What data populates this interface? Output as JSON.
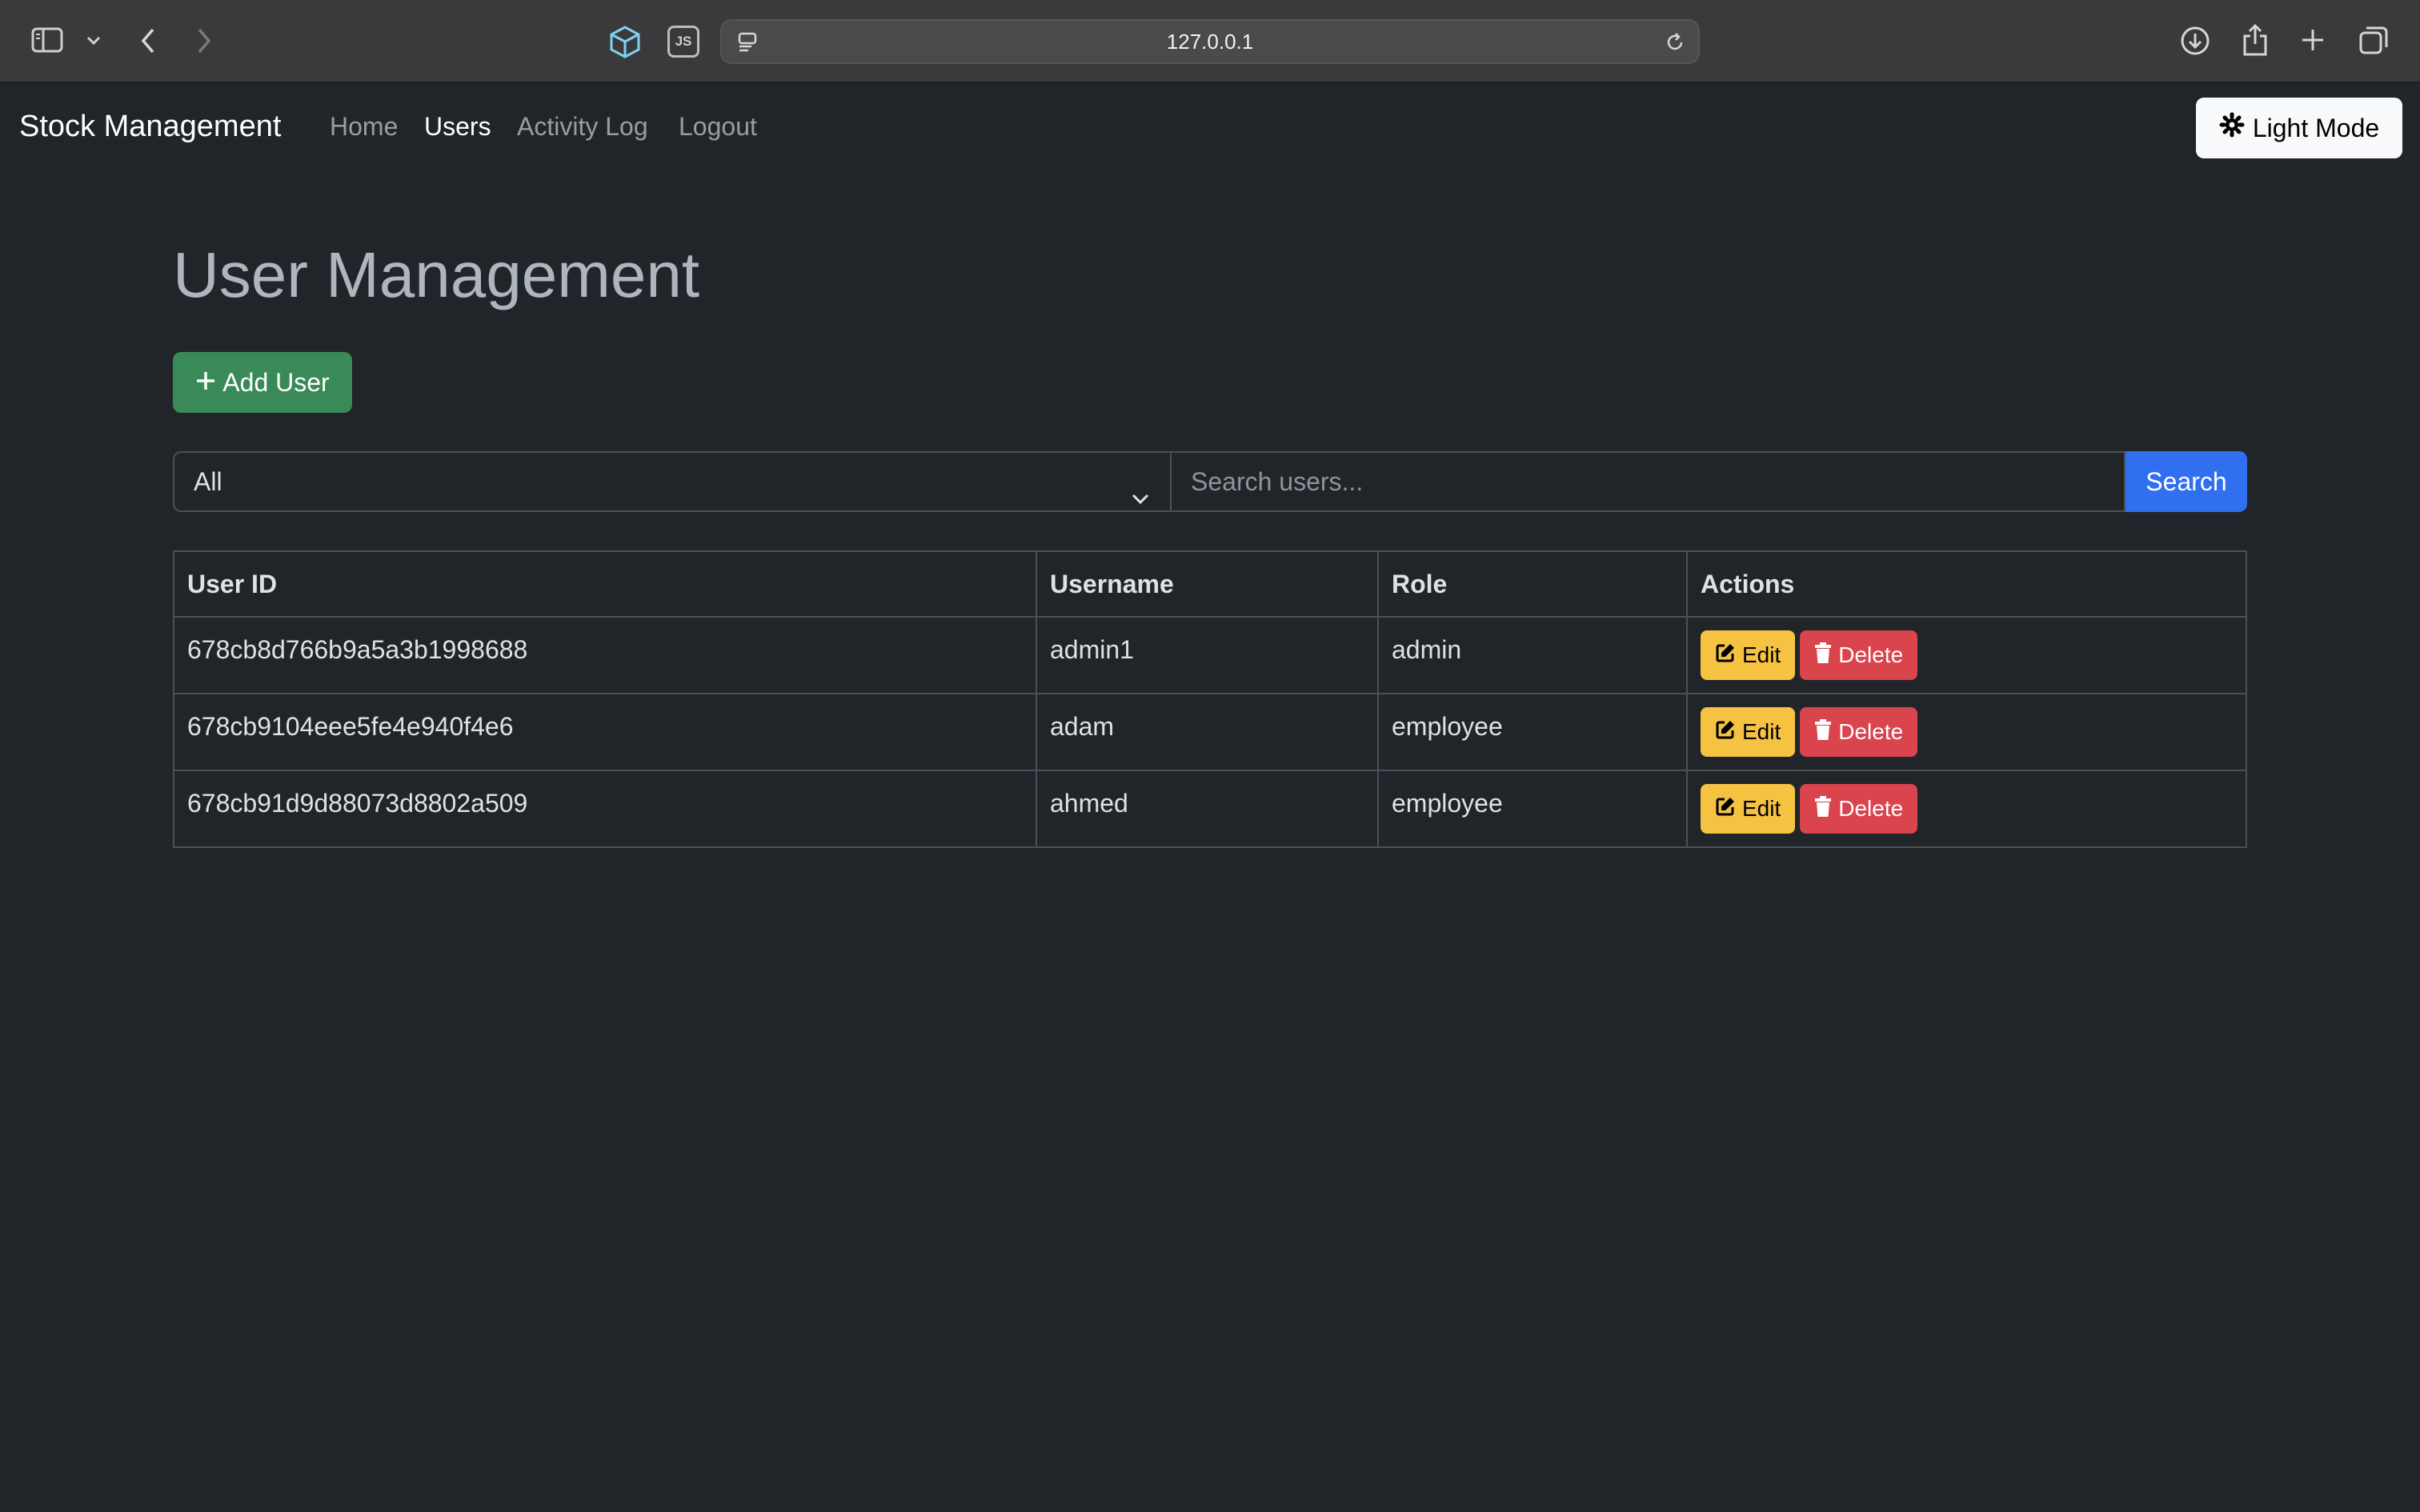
{
  "browser": {
    "url": "127.0.0.1",
    "js_badge": "JS"
  },
  "navbar": {
    "brand": "Stock Management",
    "links": [
      {
        "label": "Home",
        "active": false
      },
      {
        "label": "Users",
        "active": true
      },
      {
        "label": "Activity Log",
        "active": false
      },
      {
        "label": "Logout",
        "active": false
      }
    ],
    "theme_toggle_label": "Light Mode"
  },
  "page": {
    "title": "User Management",
    "add_user_label": "Add User"
  },
  "filter": {
    "role_selected": "All",
    "search_placeholder": "Search users...",
    "search_button_label": "Search"
  },
  "table": {
    "headers": [
      "User ID",
      "Username",
      "Role",
      "Actions"
    ],
    "rows": [
      {
        "id": "678cb8d766b9a5a3b1998688",
        "username": "admin1",
        "role": "admin"
      },
      {
        "id": "678cb9104eee5fe4e940f4e6",
        "username": "adam",
        "role": "employee"
      },
      {
        "id": "678cb91d9d88073d8802a509",
        "username": "ahmed",
        "role": "employee"
      }
    ],
    "edit_label": "Edit",
    "delete_label": "Delete"
  },
  "colors": {
    "background": "#212529",
    "success": "#3a8a57",
    "primary": "#2f6ff0",
    "warning": "#f5c242",
    "danger": "#d9444d"
  }
}
